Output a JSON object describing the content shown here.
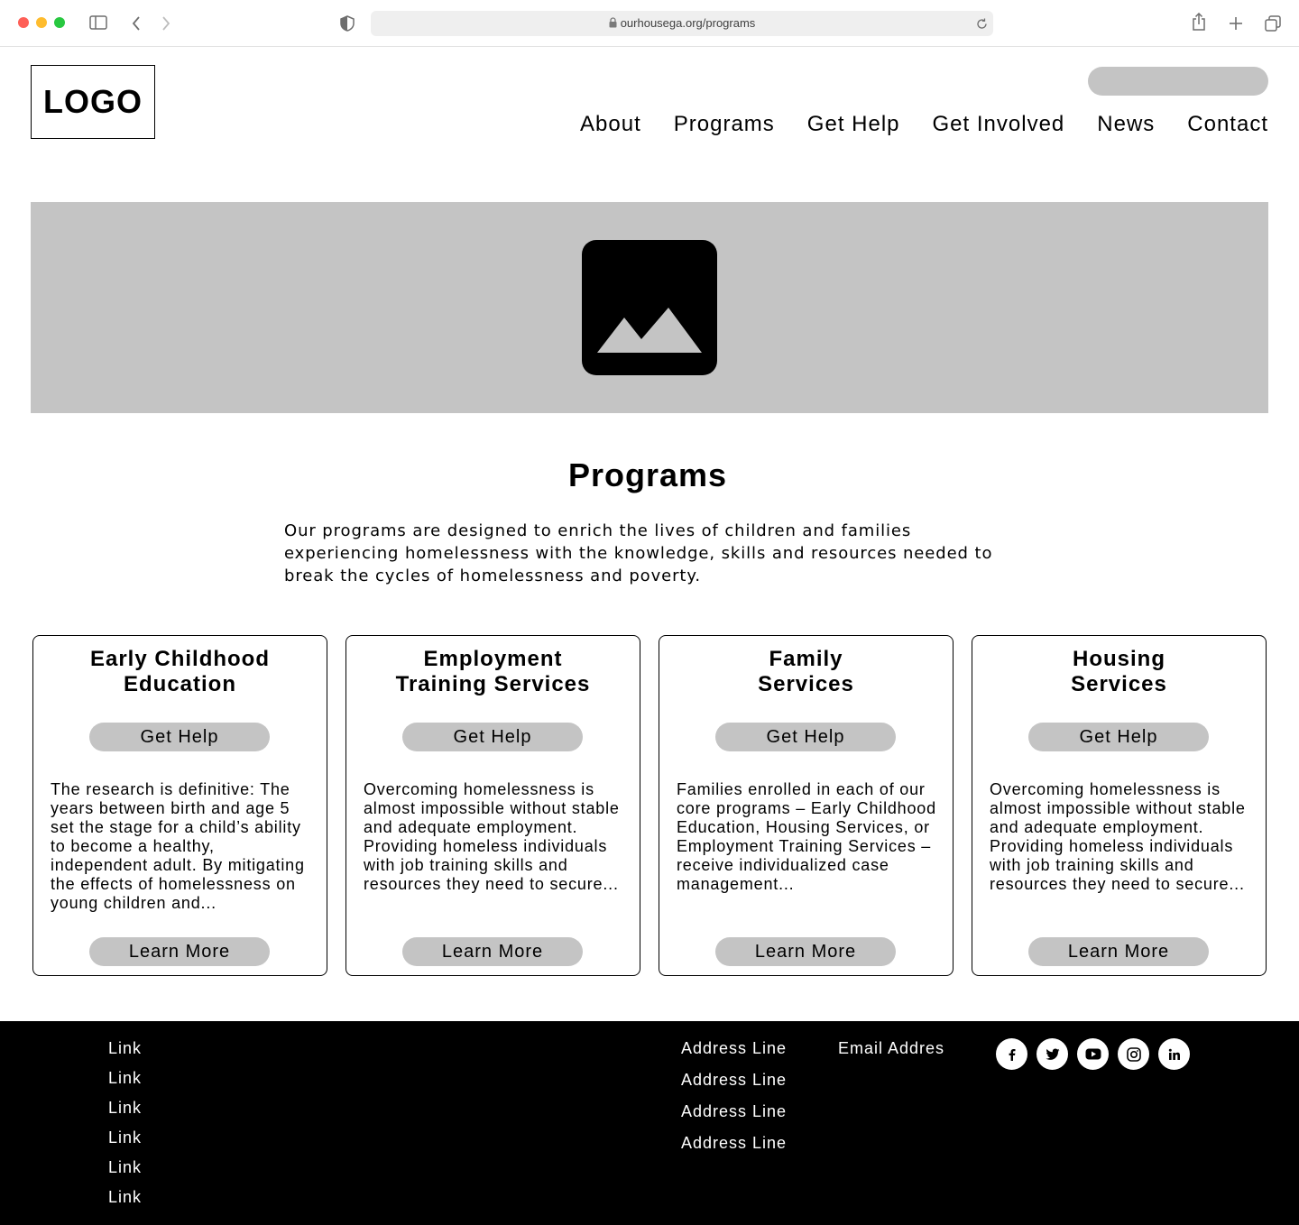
{
  "browser": {
    "url": "ourhousega.org/programs"
  },
  "header": {
    "logo": "LOGO",
    "nav": [
      "About",
      "Programs",
      "Get Help",
      "Get Involved",
      "News",
      "Contact"
    ]
  },
  "main": {
    "title": "Programs",
    "intro": "Our programs are designed to enrich the lives of children and families experiencing homelessness with the knowledge, skills and resources needed to break the cycles of homelessness and poverty.",
    "cards": [
      {
        "title_line1": "Early Childhood",
        "title_line2": "Education",
        "cta": "Get Help",
        "text": "The research is definitive: The years between birth and age 5 set the stage for a child’s ability to become a healthy, independent adult. By mitigating the effects of homelessness on young children and...",
        "more": "Learn More"
      },
      {
        "title_line1": "Employment",
        "title_line2": "Training Services",
        "cta": "Get Help",
        "text": "Overcoming homelessness is almost impossible without stable and adequate employment. Providing homeless individuals with job training skills and resources they need to secure...",
        "more": "Learn More"
      },
      {
        "title_line1": "Family",
        "title_line2": "Services",
        "cta": "Get Help",
        "text": "Families enrolled in each of our core programs – Early Childhood Education, Housing Services, or Employment Training Services – receive individualized case management...",
        "more": "Learn More"
      },
      {
        "title_line1": "Housing",
        "title_line2": "Services",
        "cta": "Get Help",
        "text": "Overcoming homelessness is almost impossible without stable and adequate employment. Providing homeless individuals with job training skills and resources they need to secure...",
        "more": "Learn More"
      }
    ]
  },
  "footer": {
    "links": [
      "Link",
      "Link",
      "Link",
      "Link",
      "Link",
      "Link"
    ],
    "address": [
      "Address Line",
      "Address Line",
      "Address Line",
      "Address Line"
    ],
    "email": "Email Addres",
    "socials": [
      "facebook-icon",
      "twitter-icon",
      "youtube-icon",
      "instagram-icon",
      "linkedin-icon"
    ]
  },
  "colors": {
    "placeholder_gray": "#c4c4c4",
    "footer_bg": "#000000",
    "traffic_red": "#fe5f57",
    "traffic_yellow": "#febc2e",
    "traffic_green": "#28c840"
  }
}
